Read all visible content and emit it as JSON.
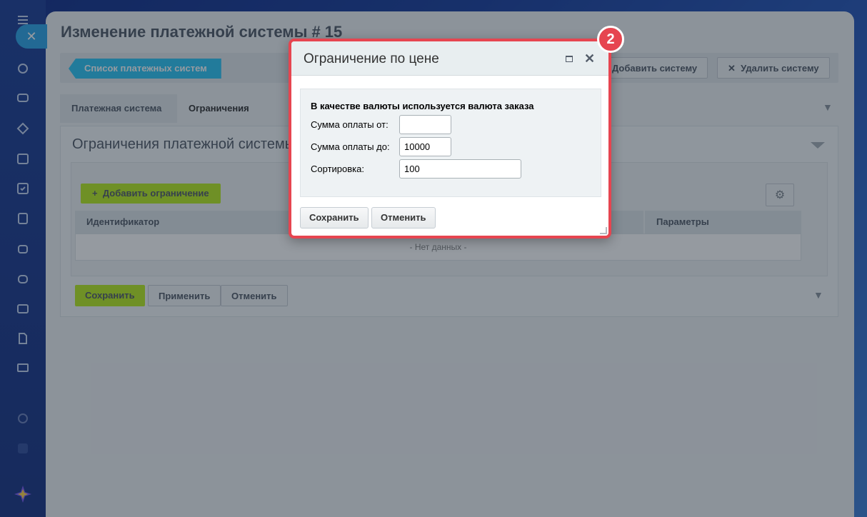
{
  "page": {
    "title": "Изменение платежной системы # 15"
  },
  "toolbar": {
    "back_label": "Список платежных систем",
    "add_label": "Добавить систему",
    "delete_label": "Удалить систему"
  },
  "tabs": [
    {
      "label": "Платежная система"
    },
    {
      "label": "Ограничения"
    }
  ],
  "section": {
    "title": "Ограничения платежной системы",
    "add_restriction_label": "Добавить ограничение",
    "columns": [
      "Идентификатор",
      "Параметры"
    ],
    "empty_text": "- Нет данных -"
  },
  "footer": {
    "save_label": "Сохранить",
    "apply_label": "Применить",
    "cancel_label": "Отменить"
  },
  "dialog": {
    "title": "Ограничение по цене",
    "hint": "В качестве валюты используется валюта заказа",
    "fields": {
      "min_label": "Сумма оплаты от:",
      "min_value": "",
      "max_label": "Сумма оплаты до:",
      "max_value": "10000",
      "sort_label": "Сортировка:",
      "sort_value": "100"
    },
    "save_label": "Сохранить",
    "cancel_label": "Отменить"
  },
  "badge": {
    "step": "2"
  },
  "colors": {
    "accent_red": "#e64550",
    "accent_blue": "#2fc6f6",
    "accent_green": "#bbed21"
  }
}
